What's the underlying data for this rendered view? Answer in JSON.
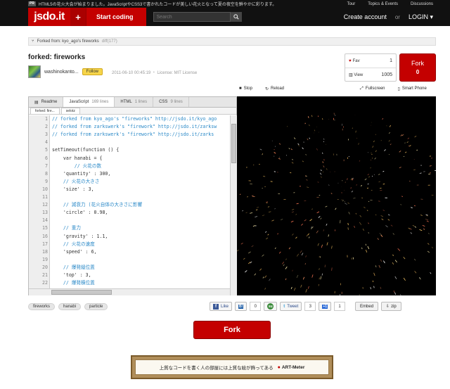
{
  "topbar": {
    "badge": "PR",
    "news": "HTML5の花火大会が始まりました。JavaScriptやCSS3で書かれたコードが美しい花火となって夏の夜空を鮮やかに彩ります。",
    "links": [
      "Tour",
      "Topics & Events",
      "Discussions"
    ]
  },
  "header": {
    "logo": "jsdo.it",
    "plus": "+",
    "start_coding": "Start coding",
    "search_placeholder": "Search",
    "create_account": "Create account",
    "or": "or",
    "login": "LOGIN ▾"
  },
  "forked_from": {
    "text": "Forked from: kyo_ago's fireworks",
    "diff": "diff(177)"
  },
  "title": "forked: fireworks",
  "user": {
    "name": "washinokanto...",
    "follow": "Follow",
    "meta": "2011-06-10 00:45:19 ・ License: MIT License"
  },
  "stats": {
    "fav_label": "Fav",
    "fav_count": "1",
    "view_label": "View",
    "view_count": "1005",
    "fork_label": "Fork",
    "fork_count": "0"
  },
  "toolbar": {
    "stop": "Stop",
    "reload": "Reload",
    "fullscreen": "Fullscreen",
    "smartphone": "Smart Phone"
  },
  "editor": {
    "tabs": [
      {
        "label": "Readme",
        "lines": ""
      },
      {
        "label": "JavaScript",
        "lines": "169 lines"
      },
      {
        "label": "HTML",
        "lines": "1 lines"
      },
      {
        "label": "CSS",
        "lines": "9 lines"
      }
    ],
    "subtabs": [
      "forked: fire...",
      "selotz"
    ],
    "code": [
      {
        "n": "1",
        "t": "// forked from kyo_ago's \"fireworks\" http://jsdo.it/kyo_ago",
        "k": "cm"
      },
      {
        "n": "2",
        "t": "// forked from zarkswerk's \"firework\" http://jsdo.it/zarksw",
        "k": "cm"
      },
      {
        "n": "3",
        "t": "// forked from zarkswerk's \"firework\" http://jsdo.it/zarks",
        "k": "cm"
      },
      {
        "n": "4",
        "t": "",
        "k": ""
      },
      {
        "n": "5",
        "t": "setTimeout(function () {",
        "k": ""
      },
      {
        "n": "6",
        "t": "    var hanabi = {",
        "k": ""
      },
      {
        "n": "7",
        "t": "        // 火花の数",
        "k": "cm"
      },
      {
        "n": "8",
        "t": "    'quantity' : 300,",
        "k": ""
      },
      {
        "n": "9",
        "t": "    // 火花の大きさ",
        "k": "cm"
      },
      {
        "n": "10",
        "t": "    'size' : 3,",
        "k": ""
      },
      {
        "n": "11",
        "t": "",
        "k": ""
      },
      {
        "n": "12",
        "t": "    // 減衰力 (花火自体の大きさに影響",
        "k": "cm"
      },
      {
        "n": "13",
        "t": "    'circle' : 0.98,",
        "k": ""
      },
      {
        "n": "14",
        "t": "",
        "k": ""
      },
      {
        "n": "15",
        "t": "    // 重力",
        "k": "cm"
      },
      {
        "n": "16",
        "t": "    'gravity' : 1.1,",
        "k": ""
      },
      {
        "n": "17",
        "t": "    // 火花の速度",
        "k": "cm"
      },
      {
        "n": "18",
        "t": "    'speed' : 6,",
        "k": ""
      },
      {
        "n": "19",
        "t": "",
        "k": ""
      },
      {
        "n": "20",
        "t": "    // 爆発縦位置",
        "k": "cm"
      },
      {
        "n": "21",
        "t": "    'top' : 3,",
        "k": ""
      },
      {
        "n": "22",
        "t": "    // 爆発横位置",
        "k": "cm"
      },
      {
        "n": "23",
        "t": "",
        "k": ""
      }
    ]
  },
  "tags": [
    "fireworks",
    "hanabi",
    "particle"
  ],
  "social": {
    "like": "Like",
    "b_count": "0",
    "tweet": "Tweet",
    "tweet_count": "3",
    "plus_one": "+1",
    "plus_count": "1",
    "embed": "Embed",
    "zip": "zip"
  },
  "bottom_fork": "Fork",
  "banner": {
    "text": "上質なコードを書く人の部屋には上質な絵が飾ってある",
    "brand": "ART-Meter"
  }
}
